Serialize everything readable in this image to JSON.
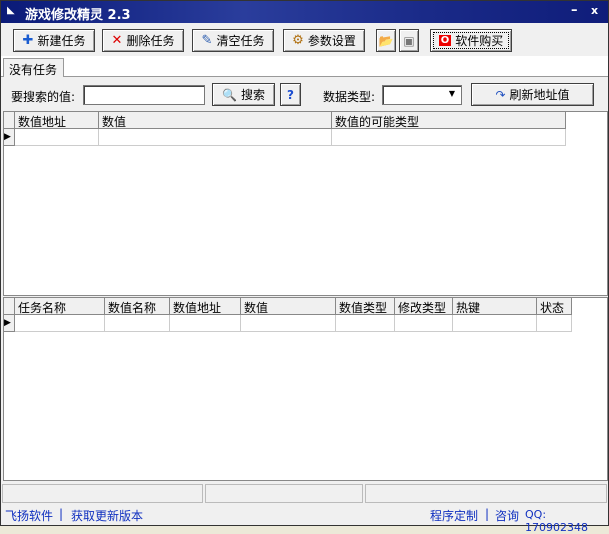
{
  "window": {
    "title": "游戏修改精灵 2.3",
    "minimize": "–",
    "close": "x"
  },
  "toolbar": {
    "new_task": "新建任务",
    "delete_task": "删除任务",
    "clear_tasks": "清空任务",
    "settings": "参数设置",
    "buy": "软件购买"
  },
  "tabs": [
    {
      "label": "没有任务"
    }
  ],
  "search": {
    "label": "要搜索的值:",
    "value": "",
    "button": "搜索",
    "help": "?",
    "type_label": "数据类型:",
    "type_value": "",
    "refresh": "刷新地址值"
  },
  "results_grid": {
    "columns": [
      "数值地址",
      "数值",
      "数值的可能类型"
    ]
  },
  "task_grid": {
    "columns": [
      "任务名称",
      "数值名称",
      "数值地址",
      "数值",
      "数值类型",
      "修改类型",
      "热键",
      "状态"
    ]
  },
  "footer": {
    "left_links": [
      "飞扬软件",
      "获取更新版本"
    ],
    "right_links": [
      "程序定制",
      "咨询"
    ],
    "qq": "QQ: 170902348",
    "sep": "|"
  }
}
